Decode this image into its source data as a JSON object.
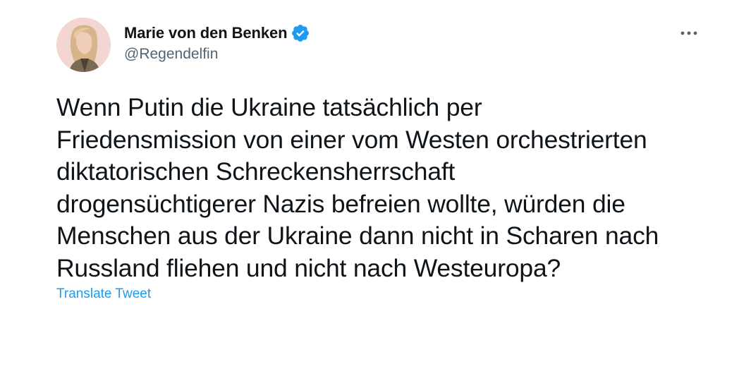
{
  "tweet": {
    "author": {
      "display_name": "Marie von den Benken",
      "handle": "@Regendelfin",
      "verified": true,
      "avatar_icon": "profile-photo"
    },
    "text_lines": [
      "Wenn Putin die Ukraine tatsächlich per",
      "Friedensmission von einer vom Westen orchestrierten",
      "diktatorischen Schreckensherrschaft",
      "drogensüchtigerer Nazis befreien wollte, würden die",
      "Menschen aus der Ukraine dann nicht in Scharen nach",
      "Russland fliehen und nicht nach Westeuropa?"
    ],
    "translate_label": "Translate Tweet",
    "more_icon": "more-horizontal-icon"
  },
  "colors": {
    "text_primary": "#0f1419",
    "text_secondary": "#536471",
    "accent": "#1d9bf0",
    "background": "#ffffff"
  }
}
